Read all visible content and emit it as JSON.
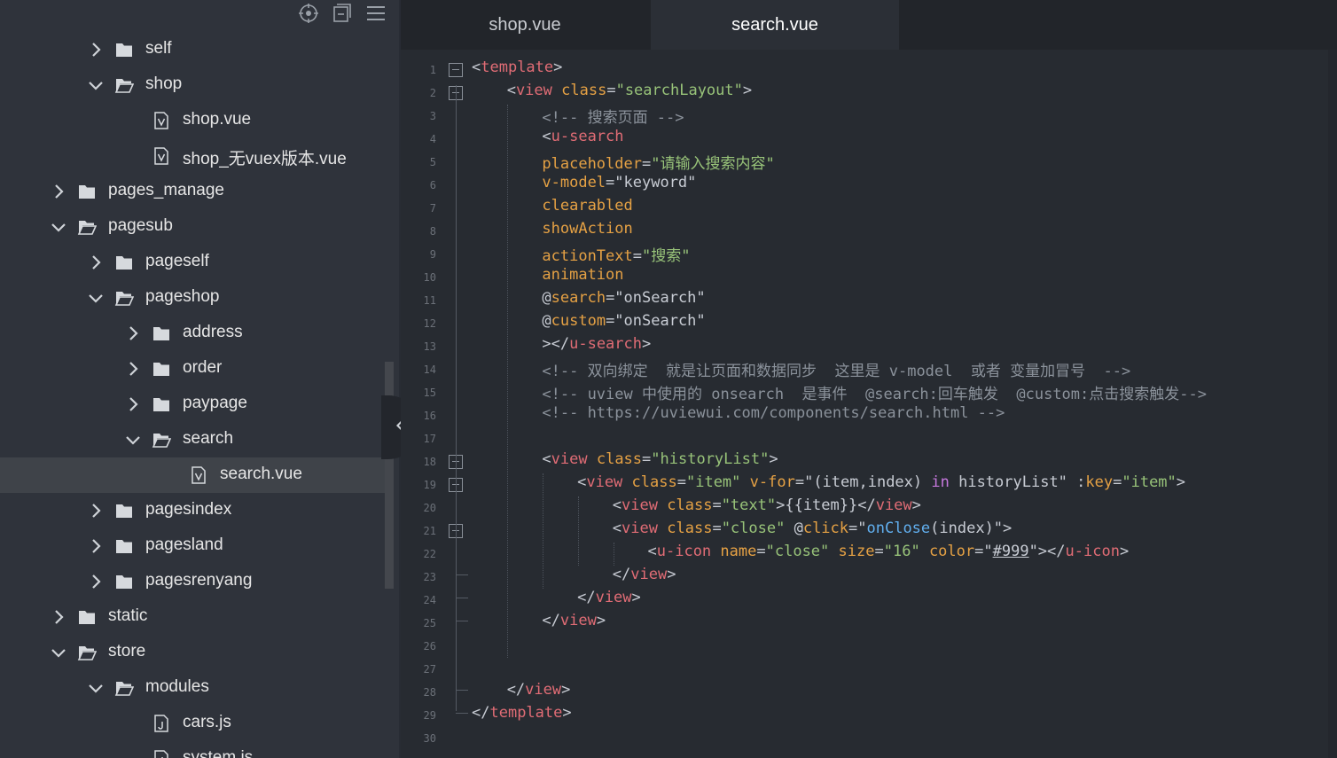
{
  "sidebar": {
    "toolbar": [
      {
        "icon": "target-icon"
      },
      {
        "icon": "collapse-all-icon"
      },
      {
        "icon": "menu-icon"
      }
    ],
    "rows": [
      {
        "label": "self",
        "kind": "folder",
        "expanded": false,
        "depth": 2,
        "selected": false
      },
      {
        "label": "shop",
        "kind": "folder",
        "expanded": true,
        "depth": 2,
        "selected": false
      },
      {
        "label": "shop.vue",
        "kind": "vue-file",
        "depth": 3,
        "selected": false
      },
      {
        "label": "shop_无vuex版本.vue",
        "kind": "vue-file",
        "depth": 3,
        "selected": false
      },
      {
        "label": "pages_manage",
        "kind": "folder",
        "expanded": false,
        "depth": 1,
        "selected": false
      },
      {
        "label": "pagesub",
        "kind": "folder",
        "expanded": true,
        "depth": 1,
        "selected": false
      },
      {
        "label": "pageself",
        "kind": "folder",
        "expanded": false,
        "depth": 2,
        "selected": false
      },
      {
        "label": "pageshop",
        "kind": "folder",
        "expanded": true,
        "depth": 2,
        "selected": false
      },
      {
        "label": "address",
        "kind": "folder",
        "expanded": false,
        "depth": 3,
        "selected": false
      },
      {
        "label": "order",
        "kind": "folder",
        "expanded": false,
        "depth": 3,
        "selected": false
      },
      {
        "label": "paypage",
        "kind": "folder",
        "expanded": false,
        "depth": 3,
        "selected": false
      },
      {
        "label": "search",
        "kind": "folder",
        "expanded": true,
        "depth": 3,
        "selected": false
      },
      {
        "label": "search.vue",
        "kind": "vue-file",
        "depth": 4,
        "selected": true
      },
      {
        "label": "pagesindex",
        "kind": "folder",
        "expanded": false,
        "depth": 2,
        "selected": false
      },
      {
        "label": "pagesland",
        "kind": "folder",
        "expanded": false,
        "depth": 2,
        "selected": false
      },
      {
        "label": "pagesrenyang",
        "kind": "folder",
        "expanded": false,
        "depth": 2,
        "selected": false
      },
      {
        "label": "static",
        "kind": "folder",
        "expanded": false,
        "depth": 1,
        "selected": false
      },
      {
        "label": "store",
        "kind": "folder",
        "expanded": true,
        "depth": 1,
        "selected": false
      },
      {
        "label": "modules",
        "kind": "folder",
        "expanded": true,
        "depth": 2,
        "selected": false
      },
      {
        "label": "cars.js",
        "kind": "js-file",
        "depth": 3,
        "selected": false
      },
      {
        "label": "system.js",
        "kind": "js-file",
        "depth": 3,
        "selected": false
      }
    ]
  },
  "tabs": [
    {
      "label": "shop.vue",
      "active": false
    },
    {
      "label": "search.vue",
      "active": true
    }
  ],
  "editor": {
    "line_numbers": [
      "1",
      "2",
      "3",
      "4",
      "5",
      "6",
      "7",
      "8",
      "9",
      "10",
      "11",
      "12",
      "13",
      "14",
      "15",
      "16",
      "17",
      "18",
      "19",
      "20",
      "21",
      "22",
      "23",
      "24",
      "25",
      "26",
      "27",
      "28",
      "29",
      "30"
    ],
    "lines": [
      {
        "indent": 0,
        "tokens": [
          [
            "pun",
            "<"
          ],
          [
            "tag",
            "template"
          ],
          [
            "pun",
            ">"
          ]
        ]
      },
      {
        "indent": 1,
        "tokens": [
          [
            "pun",
            "<"
          ],
          [
            "tag",
            "view"
          ],
          [
            "pun",
            " "
          ],
          [
            "attr",
            "class"
          ],
          [
            "pun",
            "="
          ],
          [
            "str",
            "\"searchLayout\""
          ],
          [
            "pun",
            ">"
          ]
        ]
      },
      {
        "indent": 2,
        "tokens": [
          [
            "cmt",
            "<!-- 搜索页面 -->"
          ]
        ]
      },
      {
        "indent": 2,
        "tokens": [
          [
            "pun",
            "<"
          ],
          [
            "tag",
            "u-search"
          ]
        ]
      },
      {
        "indent": 2,
        "tokens": [
          [
            "attr",
            "placeholder"
          ],
          [
            "pun",
            "="
          ],
          [
            "str",
            "\"请输入搜索内容\""
          ]
        ]
      },
      {
        "indent": 2,
        "tokens": [
          [
            "attr",
            "v-model"
          ],
          [
            "pun",
            "=\"keyword\""
          ]
        ]
      },
      {
        "indent": 2,
        "tokens": [
          [
            "attr",
            "clearabled"
          ]
        ]
      },
      {
        "indent": 2,
        "tokens": [
          [
            "attr",
            "showAction"
          ]
        ]
      },
      {
        "indent": 2,
        "tokens": [
          [
            "attr",
            "actionText"
          ],
          [
            "pun",
            "="
          ],
          [
            "str",
            "\"搜索\""
          ]
        ]
      },
      {
        "indent": 2,
        "tokens": [
          [
            "attr",
            "animation"
          ]
        ]
      },
      {
        "indent": 2,
        "tokens": [
          [
            "pun",
            "@"
          ],
          [
            "attr",
            "search"
          ],
          [
            "pun",
            "=\"onSearch\""
          ]
        ]
      },
      {
        "indent": 2,
        "tokens": [
          [
            "pun",
            "@"
          ],
          [
            "attr",
            "custom"
          ],
          [
            "pun",
            "=\"onSearch\""
          ]
        ]
      },
      {
        "indent": 2,
        "tokens": [
          [
            "pun",
            "></"
          ],
          [
            "tag",
            "u-search"
          ],
          [
            "pun",
            ">"
          ]
        ]
      },
      {
        "indent": 2,
        "tokens": [
          [
            "cmt",
            "<!-- 双向绑定  就是让页面和数据同步  这里是 v-model  或者 变量加冒号  -->"
          ]
        ]
      },
      {
        "indent": 2,
        "tokens": [
          [
            "cmt",
            "<!-- uview 中使用的 onsearch  是事件  @search:回车触发  @custom:点击搜索触发-->"
          ]
        ]
      },
      {
        "indent": 2,
        "tokens": [
          [
            "cmt",
            "<!-- https://uviewui.com/components/search.html -->"
          ]
        ]
      },
      {
        "indent": 0,
        "tokens": []
      },
      {
        "indent": 2,
        "tokens": [
          [
            "pun",
            "<"
          ],
          [
            "tag",
            "view"
          ],
          [
            "pun",
            " "
          ],
          [
            "attr",
            "class"
          ],
          [
            "pun",
            "="
          ],
          [
            "str",
            "\"historyList\""
          ],
          [
            "pun",
            ">"
          ]
        ]
      },
      {
        "indent": 3,
        "tokens": [
          [
            "pun",
            "<"
          ],
          [
            "tag",
            "view"
          ],
          [
            "pun",
            " "
          ],
          [
            "attr",
            "class"
          ],
          [
            "pun",
            "="
          ],
          [
            "str",
            "\"item\""
          ],
          [
            "pun",
            " "
          ],
          [
            "attr",
            "v-for"
          ],
          [
            "pun",
            "=\"(item,index) "
          ],
          [
            "kw",
            "in"
          ],
          [
            "pun",
            " historyList\" :"
          ],
          [
            "attr",
            "key"
          ],
          [
            "pun",
            "="
          ],
          [
            "str",
            "\"item\""
          ],
          [
            "pun",
            ">"
          ]
        ]
      },
      {
        "indent": 4,
        "tokens": [
          [
            "pun",
            "<"
          ],
          [
            "tag",
            "view"
          ],
          [
            "pun",
            " "
          ],
          [
            "attr",
            "class"
          ],
          [
            "pun",
            "="
          ],
          [
            "str",
            "\"text\""
          ],
          [
            "pun",
            ">{{item}}</"
          ],
          [
            "tag",
            "view"
          ],
          [
            "pun",
            ">"
          ]
        ]
      },
      {
        "indent": 4,
        "tokens": [
          [
            "pun",
            "<"
          ],
          [
            "tag",
            "view"
          ],
          [
            "pun",
            " "
          ],
          [
            "attr",
            "class"
          ],
          [
            "pun",
            "="
          ],
          [
            "str",
            "\"close\""
          ],
          [
            "pun",
            " @"
          ],
          [
            "attr",
            "click"
          ],
          [
            "pun",
            "=\""
          ],
          [
            "fn",
            "onClose"
          ],
          [
            "pun",
            "(index)\">"
          ]
        ]
      },
      {
        "indent": 5,
        "tokens": [
          [
            "pun",
            "<"
          ],
          [
            "tag",
            "u-icon"
          ],
          [
            "pun",
            " "
          ],
          [
            "attr",
            "name"
          ],
          [
            "pun",
            "="
          ],
          [
            "str",
            "\"close\""
          ],
          [
            "pun",
            " "
          ],
          [
            "attr",
            "size"
          ],
          [
            "pun",
            "="
          ],
          [
            "str",
            "\"16\""
          ],
          [
            "pun",
            " "
          ],
          [
            "attr",
            "color"
          ],
          [
            "pun",
            "=\""
          ],
          [
            "ul",
            "#999"
          ],
          [
            "pun",
            "\"></"
          ],
          [
            "tag",
            "u-icon"
          ],
          [
            "pun",
            ">"
          ]
        ]
      },
      {
        "indent": 4,
        "tokens": [
          [
            "pun",
            "</"
          ],
          [
            "tag",
            "view"
          ],
          [
            "pun",
            ">"
          ]
        ]
      },
      {
        "indent": 3,
        "tokens": [
          [
            "pun",
            "</"
          ],
          [
            "tag",
            "view"
          ],
          [
            "pun",
            ">"
          ]
        ]
      },
      {
        "indent": 2,
        "tokens": [
          [
            "pun",
            "</"
          ],
          [
            "tag",
            "view"
          ],
          [
            "pun",
            ">"
          ]
        ]
      },
      {
        "indent": 0,
        "tokens": []
      },
      {
        "indent": 0,
        "tokens": []
      },
      {
        "indent": 1,
        "tokens": [
          [
            "pun",
            "</"
          ],
          [
            "tag",
            "view"
          ],
          [
            "pun",
            ">"
          ]
        ]
      },
      {
        "indent": 0,
        "tokens": [
          [
            "pun",
            "</"
          ],
          [
            "tag",
            "template"
          ],
          [
            "pun",
            ">"
          ]
        ]
      },
      {
        "indent": 0,
        "tokens": []
      }
    ]
  }
}
